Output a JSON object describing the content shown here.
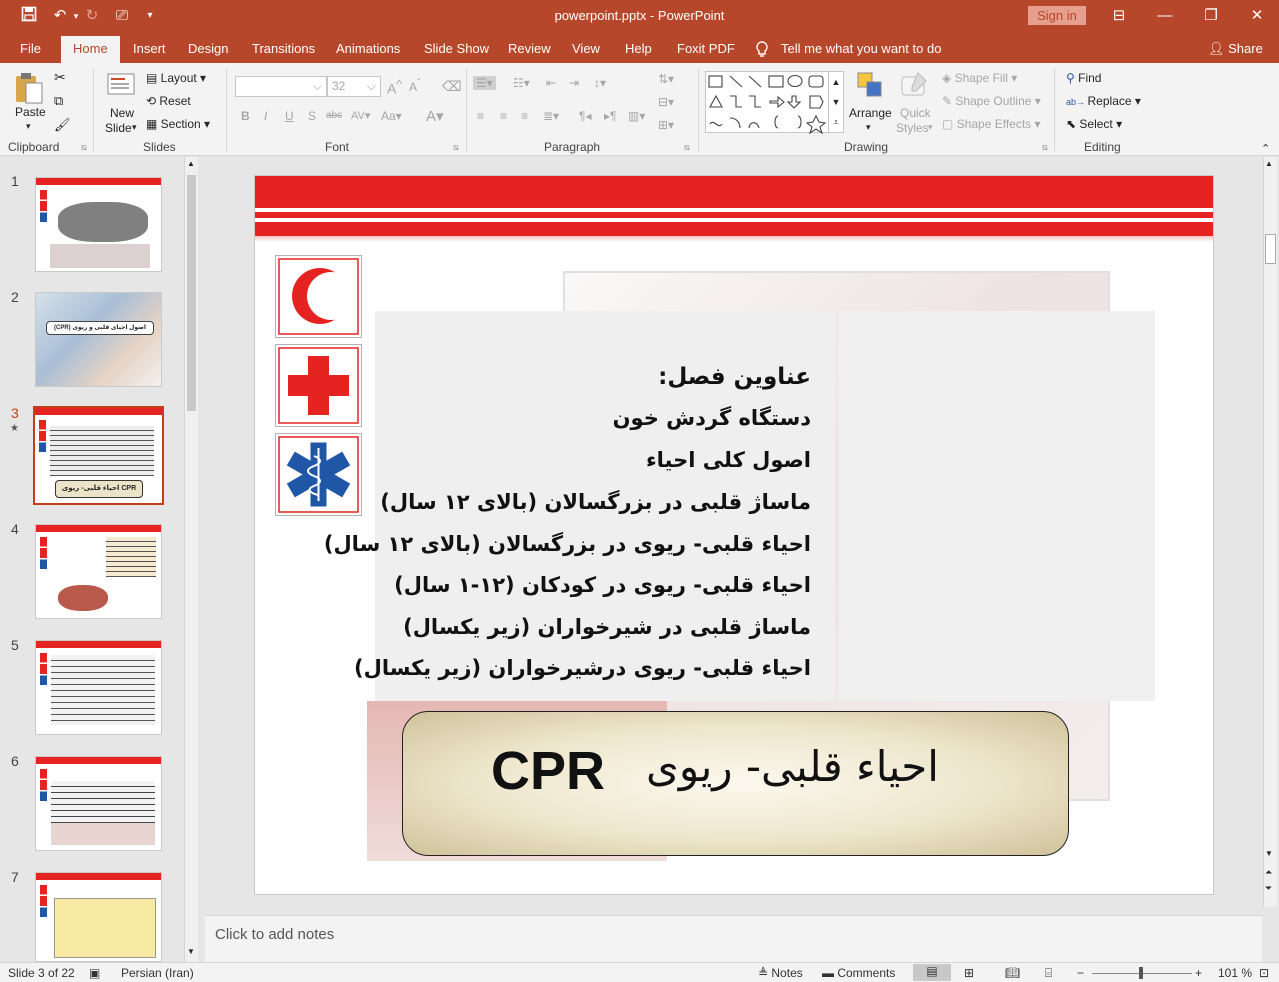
{
  "window": {
    "title": "powerpoint.pptx  -  PowerPoint",
    "signin": "Sign in"
  },
  "tabs": [
    "File",
    "Home",
    "Insert",
    "Design",
    "Transitions",
    "Animations",
    "Slide Show",
    "Review",
    "View",
    "Help",
    "Foxit PDF"
  ],
  "active_tab": "Home",
  "tellme": "Tell me what you want to do",
  "share": "Share",
  "ribbon": {
    "clipboard": {
      "paste": "Paste",
      "label": "Clipboard"
    },
    "slides": {
      "new_slide_1": "New",
      "new_slide_2": "Slide",
      "layout": "Layout",
      "reset": "Reset",
      "section": "Section",
      "label": "Slides"
    },
    "font": {
      "size": "32",
      "label": "Font"
    },
    "paragraph": {
      "label": "Paragraph"
    },
    "drawing": {
      "arrange": "Arrange",
      "quick_styles_1": "Quick",
      "quick_styles_2": "Styles",
      "shape_fill": "Shape Fill",
      "shape_outline": "Shape Outline",
      "shape_effects": "Shape Effects",
      "label": "Drawing"
    },
    "editing": {
      "find": "Find",
      "replace": "Replace",
      "select": "Select",
      "label": "Editing"
    }
  },
  "thumbnails": [
    {
      "num": "1"
    },
    {
      "num": "2",
      "caption": "اصول احیای قلبی و ریوی (CPR)"
    },
    {
      "num": "3",
      "caption": "احیاء قلبی- ریوی  CPR"
    },
    {
      "num": "4"
    },
    {
      "num": "5"
    },
    {
      "num": "6"
    },
    {
      "num": "7"
    }
  ],
  "slide": {
    "heading": "عناوین فصل:",
    "items": [
      "دستگاه گردش خون",
      "اصول کلی احیاء",
      "ماساژ قلبی در بزرگسالان (بالای ۱۲ سال)",
      "احیاء قلبی- ریوی در بزرگسالان (بالای ۱۲ سال)",
      "احیاء قلبی- ریوی در کودکان (۱۲-۱ سال)",
      "ماساژ قلبی در شیرخواران (زیر یکسال)",
      "احیاء قلبی- ریوی درشیرخواران (زیر یکسال)"
    ],
    "cpr_label": "CPR",
    "cpr_persian": "احیاء قلبی- ریوی"
  },
  "notes_placeholder": "Click to add notes",
  "status": {
    "slide": "Slide 3 of 22",
    "language": "Persian (Iran)",
    "notes": "Notes",
    "comments": "Comments",
    "zoom": "101 %"
  },
  "colors": {
    "accent": "#b7472a",
    "red_cross": "#e52421",
    "star_of_life": "#1f57a6"
  }
}
